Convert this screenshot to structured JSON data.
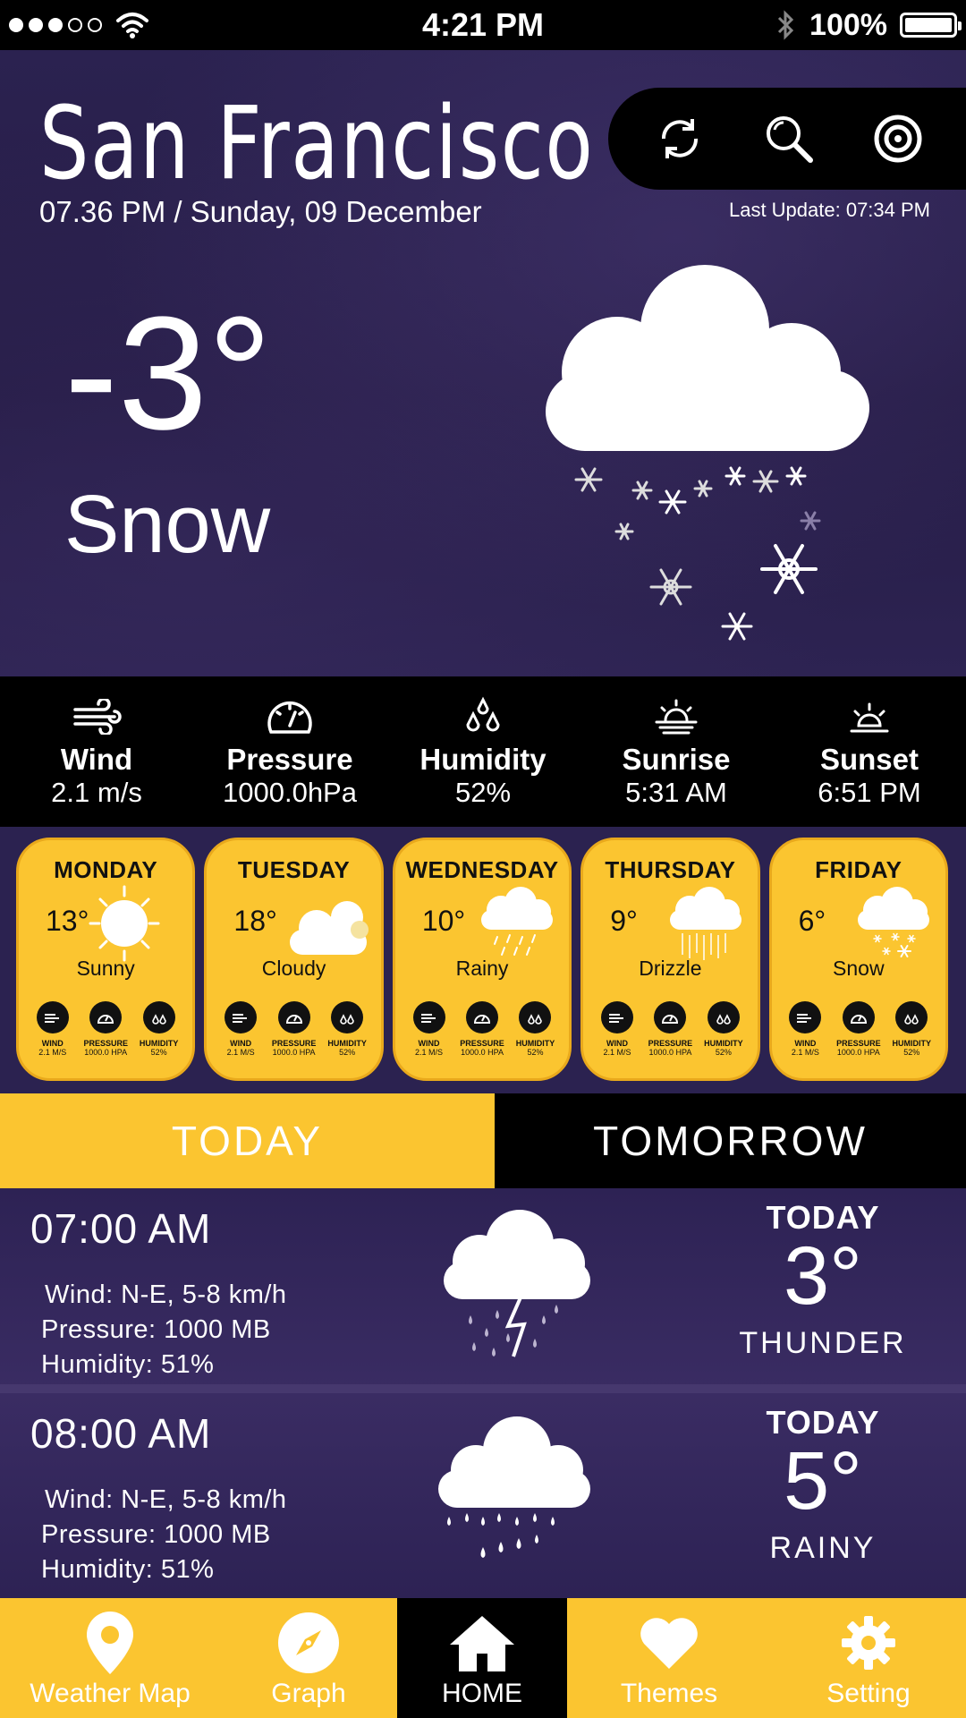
{
  "status_bar": {
    "time": "4:21 PM",
    "battery": "100%",
    "signal_icon": "signal-dots-icon",
    "wifi_icon": "wifi-icon",
    "bluetooth_icon": "bluetooth-icon",
    "battery_icon": "battery-icon"
  },
  "header": {
    "city": "San Francisco",
    "datetime": "07.36 PM / Sunday, 09 December",
    "last_update": "Last Update: 07:34 PM",
    "actions": [
      "refresh-icon",
      "search-icon",
      "location-target-icon"
    ]
  },
  "current": {
    "temperature": "-3°",
    "condition": "Snow",
    "icon": "snow-cloud-icon"
  },
  "stats": [
    {
      "label": "Wind",
      "value": "2.1 m/s",
      "icon": "wind-icon"
    },
    {
      "label": "Pressure",
      "value": "1000.0hPa",
      "icon": "gauge-icon"
    },
    {
      "label": "Humidity",
      "value": "52%",
      "icon": "droplets-icon"
    },
    {
      "label": "Sunrise",
      "value": "5:31 AM",
      "icon": "sunrise-icon"
    },
    {
      "label": "Sunset",
      "value": "6:51 PM",
      "icon": "sunset-icon"
    }
  ],
  "forecast": [
    {
      "day": "MONDAY",
      "temp": "13°",
      "condition": "Sunny",
      "icon": "sun-icon",
      "mini": [
        {
          "t": "WIND",
          "v": "2.1 M/S"
        },
        {
          "t": "PRESSURE",
          "v": "1000.0 HPA"
        },
        {
          "t": "HUMIDITY",
          "v": "52%"
        }
      ]
    },
    {
      "day": "TUESDAY",
      "temp": "18°",
      "condition": "Cloudy",
      "icon": "cloud-icon",
      "mini": [
        {
          "t": "WIND",
          "v": "2.1 M/S"
        },
        {
          "t": "PRESSURE",
          "v": "1000.0 HPA"
        },
        {
          "t": "HUMIDITY",
          "v": "52%"
        }
      ]
    },
    {
      "day": "WEDNESDAY",
      "temp": "10°",
      "condition": "Rainy",
      "icon": "rain-cloud-icon",
      "mini": [
        {
          "t": "WIND",
          "v": "2.1 M/S"
        },
        {
          "t": "PRESSURE",
          "v": "1000.0 HPA"
        },
        {
          "t": "HUMIDITY",
          "v": "52%"
        }
      ]
    },
    {
      "day": "THURSDAY",
      "temp": "9°",
      "condition": "Drizzle",
      "icon": "drizzle-cloud-icon",
      "mini": [
        {
          "t": "WIND",
          "v": "2.1 M/S"
        },
        {
          "t": "PRESSURE",
          "v": "1000.0 HPA"
        },
        {
          "t": "HUMIDITY",
          "v": "52%"
        }
      ]
    },
    {
      "day": "FRIDAY",
      "temp": "6°",
      "condition": "Snow",
      "icon": "snow-cloud-icon",
      "mini": [
        {
          "t": "WIND",
          "v": "2.1 M/S"
        },
        {
          "t": "PRESSURE",
          "v": "1000.0 HPA"
        },
        {
          "t": "HUMIDITY",
          "v": "52%"
        }
      ]
    }
  ],
  "tabs": {
    "today": "TODAY",
    "tomorrow": "TOMORROW",
    "active": "today"
  },
  "hourly": [
    {
      "time": "07:00 AM",
      "wind": "Wind: N-E, 5-8 km/h",
      "pressure": "Pressure: 1000 MB",
      "humidity": "Humidity: 51%",
      "day": "TODAY",
      "temp": "3°",
      "condition": "THUNDER",
      "icon": "thunderstorm-icon"
    },
    {
      "time": "08:00 AM",
      "wind": "Wind: N-E, 5-8 km/h",
      "pressure": "Pressure: 1000 MB",
      "humidity": "Humidity: 51%",
      "day": "TODAY",
      "temp": "5°",
      "condition": "RAINY",
      "icon": "rain-cloud-icon"
    }
  ],
  "nav": [
    {
      "label": "Weather Map",
      "icon": "map-pin-icon"
    },
    {
      "label": "Graph",
      "icon": "compass-icon"
    },
    {
      "label": "HOME",
      "icon": "home-icon",
      "active": true
    },
    {
      "label": "Themes",
      "icon": "heart-icon"
    },
    {
      "label": "Setting",
      "icon": "gear-icon"
    }
  ],
  "colors": {
    "accent": "#fbc530",
    "background": "#2b2250",
    "bar": "#000000"
  }
}
